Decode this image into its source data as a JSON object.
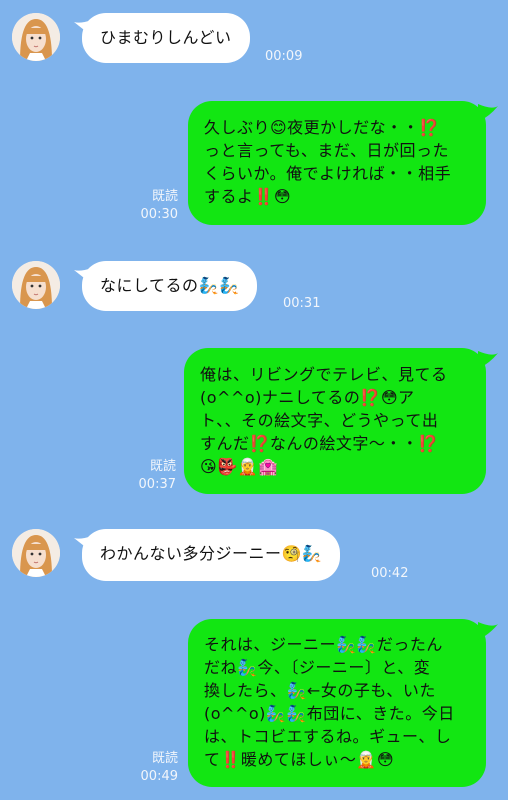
{
  "messages": [
    {
      "sender": "friend",
      "text": "ひまむりしんどい",
      "time": "00:09"
    },
    {
      "sender": "me",
      "lines": [
        "久しぶり😊夜更かしだな・・⁉️",
        "っと言っても、まだ、日が回った",
        "くらいか。俺でよければ・・相手",
        "するよ‼️😳"
      ],
      "read": "既読",
      "time": "00:30"
    },
    {
      "sender": "friend",
      "text": "なにしてるの🧞🧞",
      "time": "00:31"
    },
    {
      "sender": "me",
      "lines": [
        "俺は、リビングでテレビ、見てる",
        "(o^^o)ナニしてるの⁉️😳ア",
        "ト、、その絵文字、どうやって出",
        "すんだ⁉️なんの絵文字〜・・⁉️",
        "😘👺🧝🏩"
      ],
      "read": "既読",
      "time": "00:37"
    },
    {
      "sender": "friend",
      "text": "わかんない多分ジーニー🧐🧞",
      "time": "00:42"
    },
    {
      "sender": "me",
      "lines": [
        "それは、ジーニー🧞🧞だったん",
        "だね🧞今、〔ジーニー〕と、変",
        "換したら、🧞←女の子も、いた",
        "(o^^o)🧞🧞布団に、きた。今日",
        "は、トコビエするね。ギュー、し",
        "て‼️暖めてほしぃ〜🧝😳"
      ],
      "read": "既読",
      "time": "00:49"
    }
  ],
  "colors": {
    "background": "#7fb3ec",
    "incoming": "#ffffff",
    "outgoing": "#12e612"
  },
  "avatar_icon": "girl-avatar-icon"
}
